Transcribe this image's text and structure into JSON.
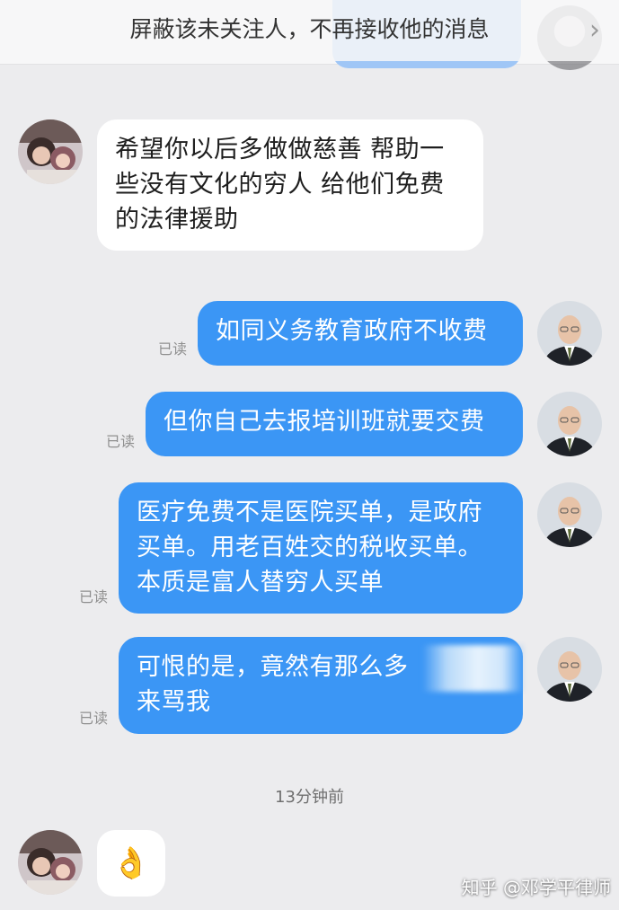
{
  "banner": {
    "text": "屏蔽该未关注人，不再接收他的消息",
    "arrow": "›"
  },
  "messages": [
    {
      "direction": "in",
      "text": "希望你以后多做做慈善 帮助一\n些没有文化的穷人 给他们免费\n的法律援助"
    },
    {
      "direction": "out",
      "text": "如同义务教育政府不收费",
      "read": "已读"
    },
    {
      "direction": "out",
      "text": "但你自己去报培训班就要交费",
      "read": "已读"
    },
    {
      "direction": "out",
      "text": "医疗免费不是医院买单，是政府\n买单。用老百姓交的税收买单。\n本质是富人替穷人买单",
      "read": "已读"
    },
    {
      "direction": "out",
      "text": "可恨的是，竟然有那么多\n来骂我",
      "read": "已读"
    }
  ],
  "timestamp": "13分钟前",
  "last_message": {
    "direction": "in",
    "emoji": "👌"
  },
  "watermark": "知乎 @邓学平律师",
  "colors": {
    "background": "#ececee",
    "bubble_out": "#3b96f5",
    "bubble_in": "#ffffff",
    "read_mark": "#8f8f8f"
  },
  "icons": {
    "banner_arrow": "chevron-right-icon",
    "user_avatar": "girl-photo-avatar",
    "lawyer_avatar": "man-in-suit-avatar"
  }
}
